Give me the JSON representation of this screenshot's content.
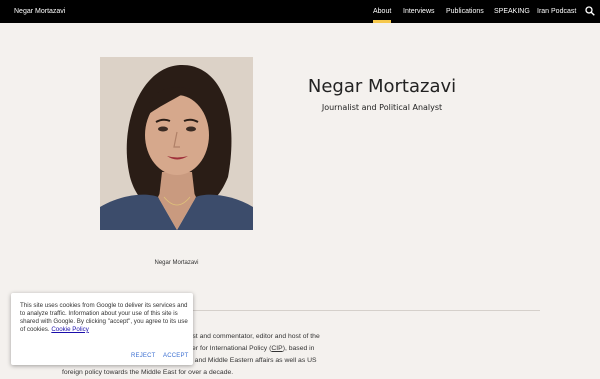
{
  "header": {
    "site_title": "Negar Mortazavi",
    "nav": [
      {
        "label": "About",
        "active": true
      },
      {
        "label": "Interviews"
      },
      {
        "label": "Publications"
      },
      {
        "label": "SPEAKING"
      },
      {
        "label": "Iran Podcast"
      }
    ],
    "search_icon": "search-icon"
  },
  "hero": {
    "name": "Negar Mortazavi",
    "subtitle": "Journalist and Political Analyst",
    "image_caption": "Negar Mortazavi"
  },
  "bio": {
    "line1": "ournalist and commentator, editor and host of the",
    "line2a": "e Center for International Policy (",
    "line2_link": "CIP",
    "line2b": "), based in",
    "line3": "Iranian and Middle Eastern affairs as well as US",
    "line4": "foreign policy towards the Middle East for over a decade."
  },
  "cookie_banner": {
    "text": "This site uses cookies from Google to deliver its services and to analyze traffic. Information about your use of this site is shared with Google. By clicking \"accept\", you agree to its use of cookies.",
    "link_label": "Cookie Policy",
    "reject_label": "REJECT",
    "accept_label": "ACCEPT"
  },
  "colors": {
    "topbar": "#000000",
    "background": "#f4f1ee",
    "active_underline": "#f6c84c",
    "button_blue": "#3b6fd1"
  }
}
